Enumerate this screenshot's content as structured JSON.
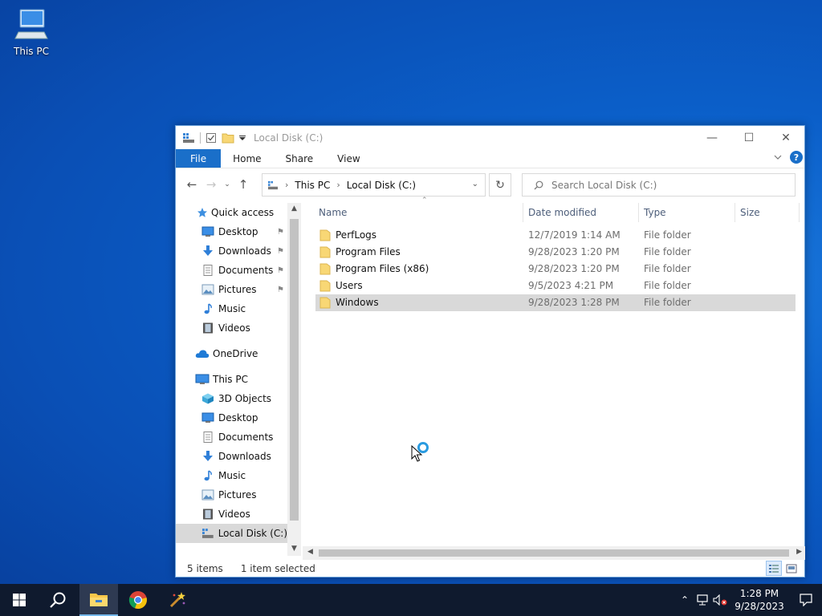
{
  "desktop": {
    "icon_label": "This PC"
  },
  "window": {
    "title": "Local Disk (C:)",
    "controls": {
      "minimize": "—",
      "maximize": "☐",
      "close": "✕"
    }
  },
  "ribbon": {
    "tabs": [
      "File",
      "Home",
      "Share",
      "View"
    ]
  },
  "address": {
    "crumbs": [
      "This PC",
      "Local Disk (C:)"
    ]
  },
  "search": {
    "placeholder": "Search Local Disk (C:)"
  },
  "nav": {
    "items": [
      {
        "label": "Quick access",
        "icon": "star-icon"
      },
      {
        "label": "Desktop",
        "icon": "desktop-icon",
        "pinned": true
      },
      {
        "label": "Downloads",
        "icon": "download-icon",
        "pinned": true
      },
      {
        "label": "Documents",
        "icon": "document-icon",
        "pinned": true
      },
      {
        "label": "Pictures",
        "icon": "pictures-icon",
        "pinned": true
      },
      {
        "label": "Music",
        "icon": "music-icon"
      },
      {
        "label": "Videos",
        "icon": "video-icon"
      },
      {
        "label": "OneDrive",
        "icon": "cloud-icon"
      },
      {
        "label": "This PC",
        "icon": "computer-icon"
      },
      {
        "label": "3D Objects",
        "icon": "cube-icon"
      },
      {
        "label": "Desktop",
        "icon": "desktop-icon"
      },
      {
        "label": "Documents",
        "icon": "document-icon"
      },
      {
        "label": "Downloads",
        "icon": "download-icon"
      },
      {
        "label": "Music",
        "icon": "music-icon"
      },
      {
        "label": "Pictures",
        "icon": "pictures-icon"
      },
      {
        "label": "Videos",
        "icon": "video-icon"
      },
      {
        "label": "Local Disk (C:)",
        "icon": "drive-icon",
        "selected": true
      }
    ]
  },
  "columns": {
    "name": "Name",
    "date": "Date modified",
    "type": "Type",
    "size": "Size"
  },
  "files": [
    {
      "name": "PerfLogs",
      "date": "12/7/2019 1:14 AM",
      "type": "File folder"
    },
    {
      "name": "Program Files",
      "date": "9/28/2023 1:20 PM",
      "type": "File folder"
    },
    {
      "name": "Program Files (x86)",
      "date": "9/28/2023 1:20 PM",
      "type": "File folder"
    },
    {
      "name": "Users",
      "date": "9/5/2023 4:21 PM",
      "type": "File folder"
    },
    {
      "name": "Windows",
      "date": "9/28/2023 1:28 PM",
      "type": "File folder",
      "selected": true
    }
  ],
  "status": {
    "items": "5 items",
    "selection": "1 item selected"
  },
  "taskbar": {
    "time": "1:28 PM",
    "date": "9/28/2023"
  },
  "colors": {
    "accent": "#1a6fc9",
    "folder": "#f8d775",
    "taskbar": "#0f1a2e"
  }
}
